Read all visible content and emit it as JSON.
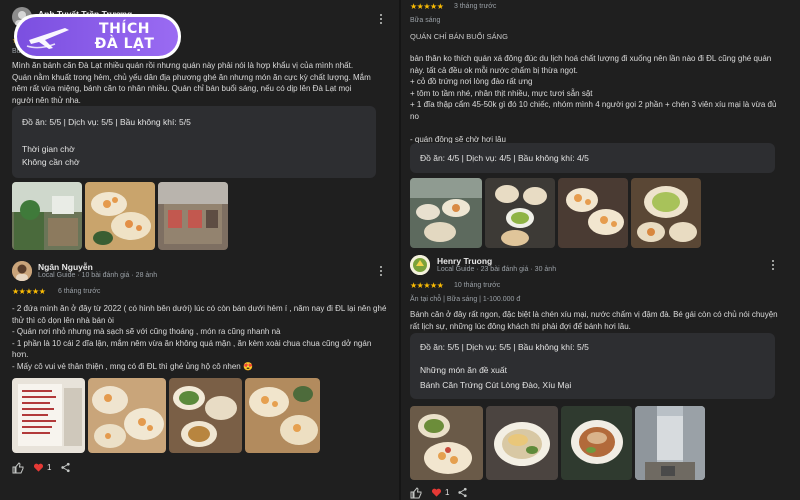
{
  "logo": {
    "line1": "THÍCH",
    "line2": "ĐÀ LẠT"
  },
  "left": {
    "review1": {
      "name": "Anh Tuyết Trần Trương",
      "stars": "★★★★★",
      "meta_partial": "Bữa",
      "text": "Mình ăn bánh căn Đà Lạt nhiều quán rồi nhưng quán này phải nói là hợp khẩu vị của mình nhất. Quán nằm khuất trong hẻm, chủ yếu dân địa phương ghé ăn nhưng món ăn cực kỳ chất lượng. Mắm nêm rất vừa miệng, bánh căn to nhân nhiều. Quán chỉ bán buổi sáng, nếu có dịp lên Đà Lạt mọi người nên thử nha.",
      "panel": {
        "ratings": "Đồ ăn: 5/5  |  Dịch vụ: 5/5  |  Bầu không khí: 5/5",
        "wait_label": "Thời gian chờ",
        "wait_value": "Không cần chờ"
      }
    },
    "review2": {
      "name": "Ngân Nguyễn",
      "sub": "Local Guide · 10 bài đánh giá · 28 ảnh",
      "stars": "★★★★★",
      "time": "6 tháng trước",
      "lines": [
        "- 2 đứa mình ăn ở đây từ 2022 ( có hình bên dưới) lúc có còn bán dưới hẻm í , năm nay đi ĐL lại nên ghé",
        "thử thì cô dọn lên nhà bán òi",
        "- Quán nơi nhỏ nhưng mà sạch sẽ với cũng thoáng , món ra cũng nhanh nà",
        "- 1 phần là 10 cái 2 dĩa lận, mắm nêm vừa ăn không quá mặn , ăn kèm xoài chua chua cũng dở ngán",
        "hơn.",
        "- Mấy cô vui vẻ thân thiện , mng có đi ĐL thì ghé ủng hộ cô nhen 😍"
      ],
      "like_count": "1"
    }
  },
  "right": {
    "review1": {
      "stars": "★★★★★",
      "time": "3 tháng trước",
      "meal": "Bữa sáng",
      "heading": "QUÁN CHỈ BÁN BUỔI SÁNG",
      "lines": [
        "bản thân ko thích quán xá đông đúc du lịch hoá chất lượng đi xuống nên lần nào đi ĐL cũng ghé quán",
        "này. tất cả đều ok mỗi nước chấm bị thừa ngọt.",
        "+ cỏ đồ trứng nơi lòng đào rất ưng",
        "+ tôm to tầm nhé, nhân thịt nhiều, mực tươi sẵn sật",
        "+ 1 đĩa thập cẩm 45-50k gì đó 10 chiếc, nhóm mình 4 người gọi 2 phần + chén 3 viên xíu mại là vừa đủ",
        "no",
        "",
        "- quán đông sẽ chờ hơi lâu"
      ],
      "panel": {
        "ratings": "Đồ ăn: 4/5  |  Dịch vụ: 4/5  |  Bầu không khí: 4/5"
      }
    },
    "review2": {
      "name": "Henry Truong",
      "sub": "Local Guide · 23 bài đánh giá · 30 ảnh",
      "stars": "★★★★★",
      "time": "10 tháng trước",
      "tags": "Ăn tại chỗ  |  Bữa sáng  |  1-100.000 đ",
      "lines": [
        "Bánh căn ở đây rất ngon, đặc biệt là chén xíu mại, nước chấm vị đậm đà. Bé gái còn có chủ nói chuyện",
        "rất lịch sự, những lúc đông khách thì phải đợi để bánh hơi lâu."
      ],
      "panel": {
        "ratings": "Đồ ăn: 5/5  |  Dịch vụ: 5/5  |  Bầu không khí: 5/5",
        "rec_label": "Những món ăn đề xuất",
        "rec_value": "Bánh Căn Trứng Cút Lòng Đào, Xíu Mại"
      },
      "like_count": "1"
    }
  },
  "icons": [
    "more-vert-icon",
    "thumb-up-icon",
    "heart-icon",
    "share-icon"
  ],
  "colors": {
    "background": "#1f1f1f",
    "panel": "#2d2e31",
    "star": "#fbbc04",
    "heart": "#e53935",
    "logo": "#8a5cf0"
  }
}
